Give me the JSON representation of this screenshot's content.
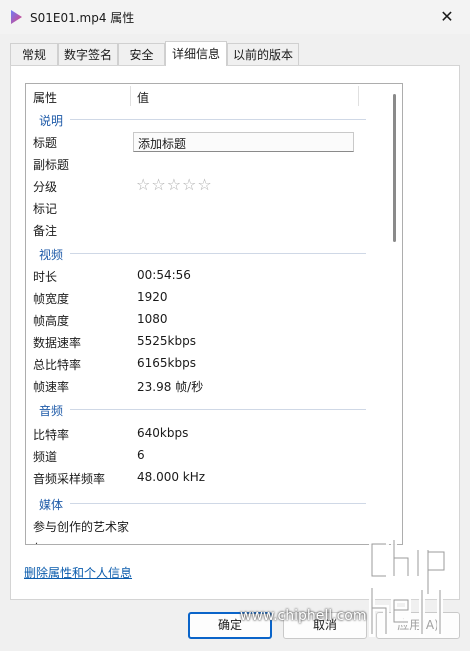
{
  "window": {
    "title": "S01E01.mp4 属性",
    "close_glyph": "✕"
  },
  "tabs": [
    {
      "label": "常规"
    },
    {
      "label": "数字签名"
    },
    {
      "label": "安全"
    },
    {
      "label": "详细信息"
    },
    {
      "label": "以前的版本"
    }
  ],
  "list": {
    "headers": {
      "property": "属性",
      "value": "值"
    },
    "description": {
      "heading": "说明",
      "rows": [
        {
          "label": "标题",
          "value": "添加标题"
        },
        {
          "label": "副标题",
          "value": ""
        },
        {
          "label": "分级",
          "value": "☆☆☆☆☆"
        },
        {
          "label": "标记",
          "value": ""
        },
        {
          "label": "备注",
          "value": ""
        }
      ]
    },
    "video": {
      "heading": "视频",
      "rows": [
        {
          "label": "时长",
          "value": "00:54:56"
        },
        {
          "label": "帧宽度",
          "value": "1920"
        },
        {
          "label": "帧高度",
          "value": "1080"
        },
        {
          "label": "数据速率",
          "value": "5525kbps"
        },
        {
          "label": "总比特率",
          "value": "6165kbps"
        },
        {
          "label": "帧速率",
          "value": "23.98 帧/秒"
        }
      ]
    },
    "audio": {
      "heading": "音频",
      "rows": [
        {
          "label": "比特率",
          "value": "640kbps"
        },
        {
          "label": "频道",
          "value": "6"
        },
        {
          "label": "音频采样频率",
          "value": "48.000 kHz"
        }
      ]
    },
    "media": {
      "heading": "媒体",
      "rows": [
        {
          "label": "参与创作的艺术家",
          "value": ""
        },
        {
          "label": "年",
          "value": ""
        }
      ]
    }
  },
  "remove_link": "删除属性和个人信息",
  "buttons": {
    "ok": "确定",
    "cancel": "取消",
    "apply": "应用(A)"
  },
  "watermark": {
    "url": "www.chiphell.com",
    "logo_text": "chip hell"
  },
  "colors": {
    "accent": "#0a64c9",
    "section": "#1e5aa8",
    "link": "#0b5cad"
  },
  "rating": {
    "stars_filled": 0,
    "stars_total": 5
  }
}
